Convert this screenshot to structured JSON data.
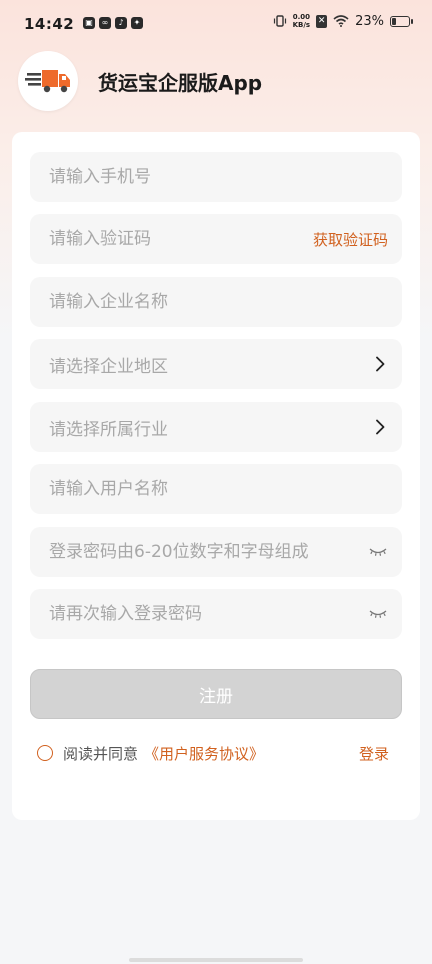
{
  "status_bar": {
    "time": "14:42",
    "net_speed_value": "0.00",
    "net_speed_unit": "KB/s",
    "battery": "23%",
    "battery_level": 0.23
  },
  "header": {
    "title": "货运宝企服版App",
    "logo_icon": "delivery-truck-icon"
  },
  "form": {
    "phone_placeholder": "请输入手机号",
    "code_placeholder": "请输入验证码",
    "get_code_label": "获取验证码",
    "company_placeholder": "请输入企业名称",
    "region_placeholder": "请选择企业地区",
    "industry_placeholder": "请选择所属行业",
    "username_placeholder": "请输入用户名称",
    "password_placeholder": "登录密码由6-20位数字和字母组成",
    "confirm_password_placeholder": "请再次输入登录密码"
  },
  "actions": {
    "register_label": "注册",
    "agree_text": "阅读并同意",
    "agreement_link": "《用户服务协议》",
    "login_label": "登录"
  },
  "colors": {
    "accent": "#d1611f",
    "logo_orange": "#ee6a2b",
    "button_disabled": "#d3d3d3"
  }
}
